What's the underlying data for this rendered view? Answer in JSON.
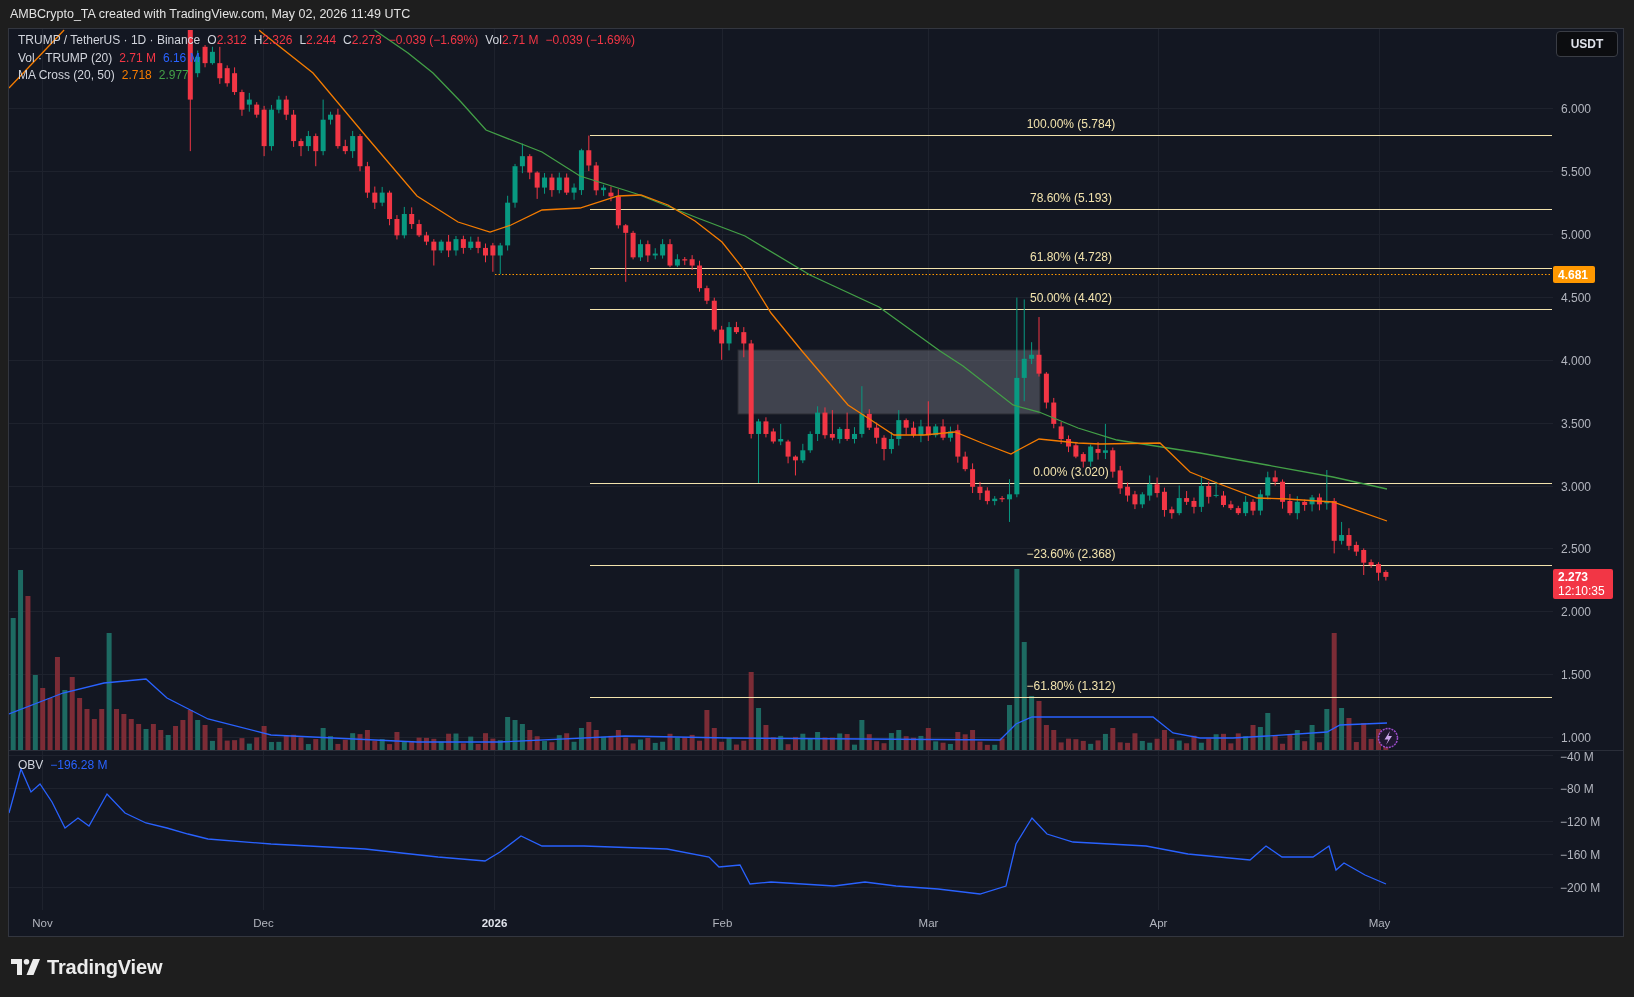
{
  "attribution": "AMBCrypto_TA created with TradingView.com, May 02, 2026 11:49 UTC",
  "legend": {
    "symbol": "TRUMP / TetherUS · 1D · Binance",
    "falling": true,
    "ohlc": [
      {
        "label": "O",
        "value": "2.312"
      },
      {
        "label": "H",
        "value": "2.326"
      },
      {
        "label": "L",
        "value": "2.244"
      },
      {
        "label": "C",
        "value": "2.273"
      }
    ],
    "change": "−0.039 (−1.69%)",
    "volume_label": "Vol",
    "volume_value": "2.71 M",
    "volume_change": "−0.039 (−1.69%)"
  },
  "indicators": [
    {
      "name": "Vol · TRUMP (20)",
      "values": [
        {
          "text": "2.71 M",
          "color": "#f23645"
        },
        {
          "text": "6.16 M",
          "color": "#2962ff"
        }
      ]
    },
    {
      "name": "MA Cross (20, 50)",
      "values": [
        {
          "text": "2.718",
          "color": "#f57c00"
        },
        {
          "text": "2.977",
          "color": "#43a047"
        }
      ]
    }
  ],
  "currency_button": "USDT",
  "fib_levels": [
    "100.00% (5.784)",
    "78.60% (5.193)",
    "61.80% (4.728)",
    "50.00% (4.402)",
    "0.00% (3.020)",
    "−23.60% (2.368)",
    "−61.80% (1.312)"
  ],
  "price_axis": [
    "6.000",
    "5.500",
    "5.000",
    "4.500",
    "4.000",
    "3.500",
    "3.000",
    "2.500",
    "2.000",
    "1.500",
    "1.000"
  ],
  "price_tags": [
    {
      "value": "4.681",
      "color": "#ff9800"
    },
    {
      "value": "2.273",
      "countdown": "12:10:35",
      "color": "#f23645"
    }
  ],
  "obv": {
    "name": "OBV",
    "value": "−196.28 M",
    "color": "#2962ff"
  },
  "obv_axis": [
    "−40 M",
    "−80 M",
    "−120 M",
    "−160 M",
    "−200 M"
  ],
  "time_axis": [
    {
      "label": "Nov",
      "kind": "month"
    },
    {
      "label": "Dec",
      "kind": "month"
    },
    {
      "label": "2026",
      "kind": "year"
    },
    {
      "label": "Feb",
      "kind": "month"
    },
    {
      "label": "Mar",
      "kind": "month"
    },
    {
      "label": "Apr",
      "kind": "month"
    },
    {
      "label": "May",
      "kind": "month"
    }
  ],
  "brand": "TradingView"
}
